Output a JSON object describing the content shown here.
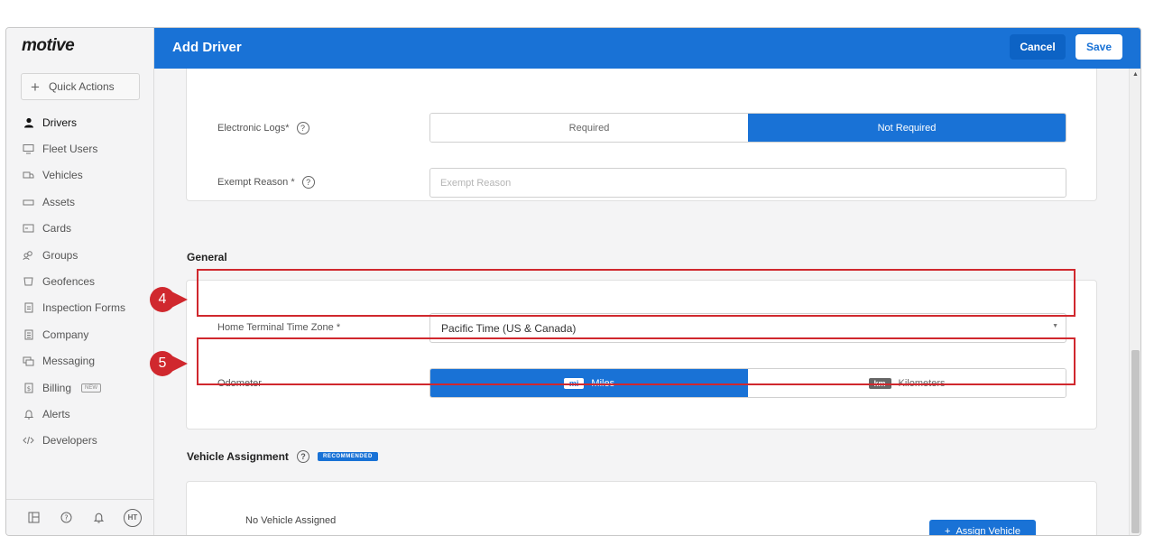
{
  "app": {
    "logo": "motive"
  },
  "sidebar": {
    "quick_actions": "Quick Actions",
    "items": [
      {
        "label": "Drivers",
        "icon": "person-icon",
        "active": true
      },
      {
        "label": "Fleet Users",
        "icon": "monitor-icon"
      },
      {
        "label": "Vehicles",
        "icon": "truck-icon"
      },
      {
        "label": "Assets",
        "icon": "trailer-icon"
      },
      {
        "label": "Cards",
        "icon": "card-icon"
      },
      {
        "label": "Groups",
        "icon": "groups-icon"
      },
      {
        "label": "Geofences",
        "icon": "geofence-icon"
      },
      {
        "label": "Inspection Forms",
        "icon": "form-icon"
      },
      {
        "label": "Company",
        "icon": "building-icon"
      },
      {
        "label": "Messaging",
        "icon": "message-icon"
      },
      {
        "label": "Billing",
        "icon": "billing-icon",
        "badge": "NEW"
      },
      {
        "label": "Alerts",
        "icon": "bell-icon"
      },
      {
        "label": "Developers",
        "icon": "code-icon"
      }
    ],
    "user_initials": "HT"
  },
  "header": {
    "title": "Add Driver",
    "cancel_label": "Cancel",
    "save_label": "Save"
  },
  "hos": {
    "electronic_logs_label": "Electronic Logs*",
    "electronic_logs_options": [
      "Required",
      "Not Required"
    ],
    "electronic_logs_selected": "Not Required",
    "exempt_reason_label": "Exempt Reason *",
    "exempt_reason_placeholder": "Exempt Reason",
    "exempt_reason_value": ""
  },
  "general": {
    "title": "General",
    "time_zone_label": "Home Terminal Time Zone *",
    "time_zone_value": "Pacific Time (US & Canada)",
    "odometer_label": "Odometer",
    "odometer_options": [
      {
        "tag": "mi",
        "label": "Miles"
      },
      {
        "tag": "km",
        "label": "Kilometers"
      }
    ],
    "odometer_selected": "Miles"
  },
  "vehicle_assignment": {
    "title": "Vehicle Assignment",
    "badge": "RECOMMENDED",
    "empty_text": "No Vehicle Assigned",
    "assign_label": "Assign Vehicle"
  },
  "annotations": {
    "marker_4": "4",
    "marker_5": "5"
  },
  "colors": {
    "accent": "#1972d6",
    "annotation": "#d0282e"
  }
}
